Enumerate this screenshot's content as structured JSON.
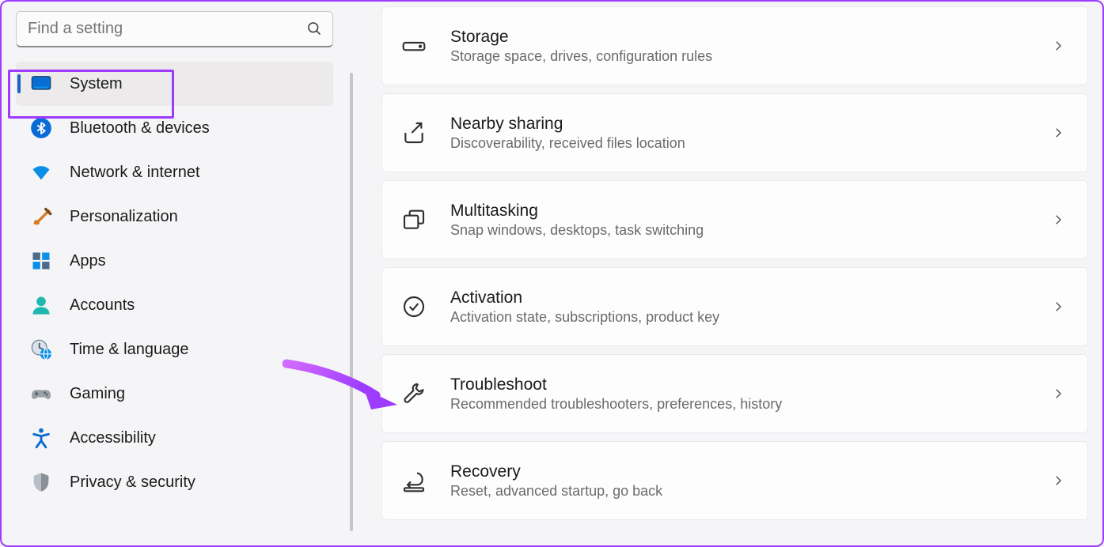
{
  "search": {
    "placeholder": "Find a setting"
  },
  "sidebar": {
    "items": [
      {
        "label": "System"
      },
      {
        "label": "Bluetooth & devices"
      },
      {
        "label": "Network & internet"
      },
      {
        "label": "Personalization"
      },
      {
        "label": "Apps"
      },
      {
        "label": "Accounts"
      },
      {
        "label": "Time & language"
      },
      {
        "label": "Gaming"
      },
      {
        "label": "Accessibility"
      },
      {
        "label": "Privacy & security"
      }
    ]
  },
  "cards": [
    {
      "title": "Storage",
      "sub": "Storage space, drives, configuration rules"
    },
    {
      "title": "Nearby sharing",
      "sub": "Discoverability, received files location"
    },
    {
      "title": "Multitasking",
      "sub": "Snap windows, desktops, task switching"
    },
    {
      "title": "Activation",
      "sub": "Activation state, subscriptions, product key"
    },
    {
      "title": "Troubleshoot",
      "sub": "Recommended troubleshooters, preferences, history"
    },
    {
      "title": "Recovery",
      "sub": "Reset, advanced startup, go back"
    }
  ]
}
